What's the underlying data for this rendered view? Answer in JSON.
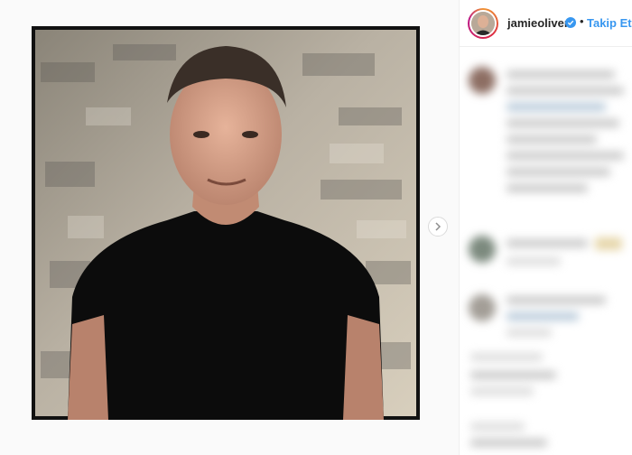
{
  "post": {
    "username": "jamieoliver",
    "dot": "•",
    "follow_label": "Takip Et"
  },
  "icons": {
    "verified": "verified-badge-icon",
    "next": "chevron-right-icon"
  },
  "colors": {
    "accent": "#3897f0",
    "text": "#262626",
    "border": "#efefef"
  }
}
